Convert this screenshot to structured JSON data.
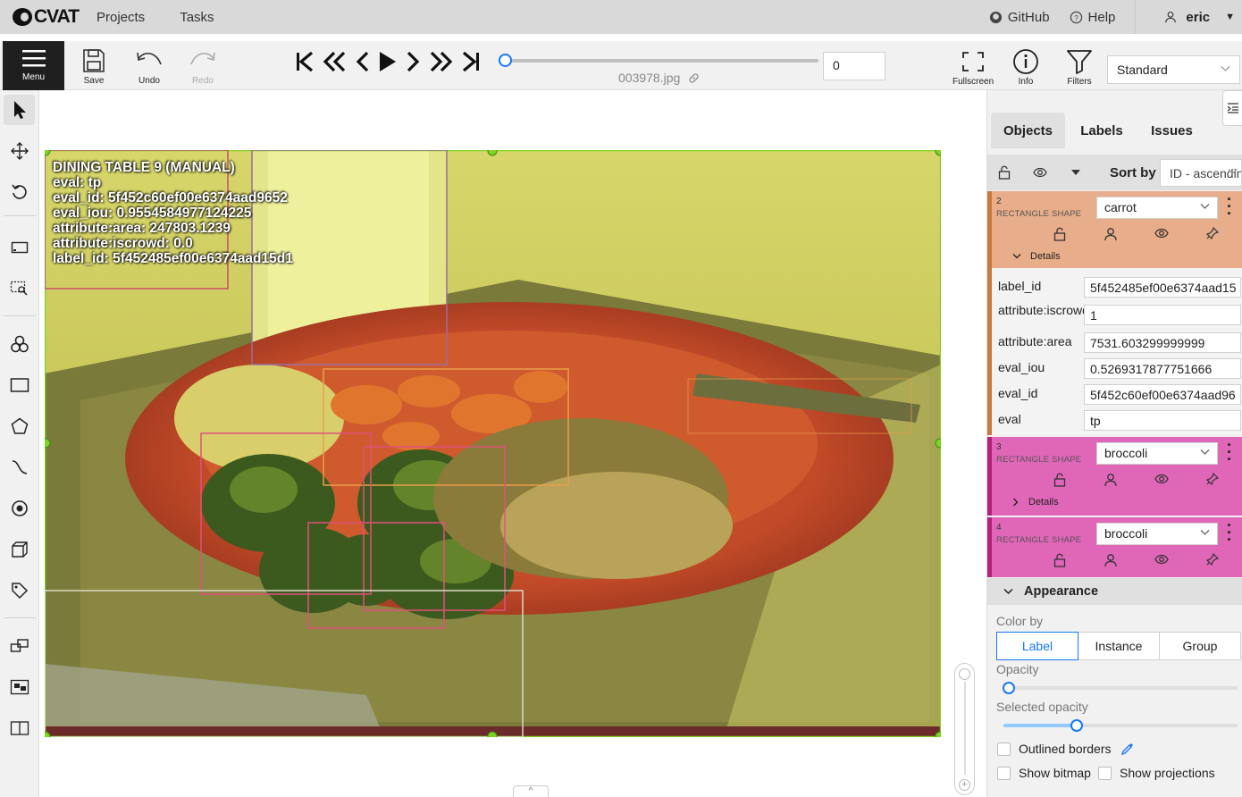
{
  "header": {
    "logo_text": "CVAT",
    "nav": [
      "Projects",
      "Tasks"
    ],
    "github": "GitHub",
    "help": "Help",
    "user": "eric"
  },
  "toolbar": {
    "menu": "Menu",
    "save": "Save",
    "undo": "Undo",
    "redo": "Redo",
    "frame_number": "0",
    "filename": "003978.jpg",
    "fullscreen": "Fullscreen",
    "info": "Info",
    "filters": "Filters",
    "workspace": "Standard",
    "frame_progress": 0.0
  },
  "canvas": {
    "overlay_lines": [
      "DINING TABLE 9 (MANUAL)",
      "eval: tp",
      "eval_id: 5f452c60ef00e6374aad9652",
      "eval_iou: 0.9554584977124225",
      "attribute:area: 247803.1239",
      "attribute:iscrowd: 0.0",
      "label_id: 5f452485ef00e6374aad15d1"
    ]
  },
  "sidebar": {
    "tabs": [
      "Objects",
      "Labels",
      "Issues"
    ],
    "sort_by_label": "Sort by",
    "sort_value": "ID - ascending",
    "objects": [
      {
        "id": "2",
        "shape": "RECTANGLE SHAPE",
        "label": "carrot",
        "color": "#e8ad8a",
        "details": "Details",
        "attributes": [
          {
            "key": "label_id",
            "value": "5f452485ef00e6374aad15"
          },
          {
            "key": "attribute:iscrowd",
            "value": "1"
          },
          {
            "key": "attribute:area",
            "value": "7531.603299999999"
          },
          {
            "key": "eval_iou",
            "value": "0.5269317877751666"
          },
          {
            "key": "eval_id",
            "value": "5f452c60ef00e6374aad96"
          },
          {
            "key": "eval",
            "value": "tp"
          }
        ]
      },
      {
        "id": "3",
        "shape": "RECTANGLE SHAPE",
        "label": "broccoli",
        "color": "#e066b8",
        "details": "Details"
      },
      {
        "id": "4",
        "shape": "RECTANGLE SHAPE",
        "label": "broccoli",
        "color": "#e066b8"
      }
    ],
    "appearance": {
      "title": "Appearance",
      "color_by_label": "Color by",
      "color_by_options": [
        "Label",
        "Instance",
        "Group"
      ],
      "color_by_selected": "Label",
      "opacity_label": "Opacity",
      "opacity_value": 0.0,
      "selected_opacity_label": "Selected opacity",
      "selected_opacity_value": 0.3,
      "outlined_borders": "Outlined borders",
      "show_bitmap": "Show bitmap",
      "show_projections": "Show projections"
    }
  },
  "colors": {
    "accent": "#1677ff",
    "topbar": "#d9d9d9",
    "toolbar": "#f1f1f1",
    "dining_table_box": "#7ed321",
    "carrot_box": "#e8a04a",
    "broccoli_box": "#e0517d"
  }
}
